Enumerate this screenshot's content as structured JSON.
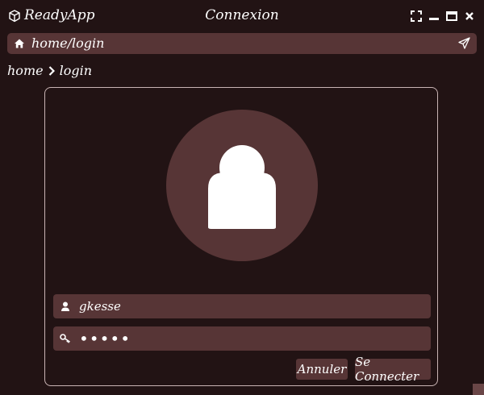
{
  "titlebar": {
    "app_name": "ReadyApp",
    "window_title": "Connexion",
    "app_icon": "cube-icon",
    "controls": [
      "fullscreen-icon",
      "minimize-icon",
      "maximize-icon",
      "close-icon"
    ]
  },
  "addressbar": {
    "path": "home/login",
    "home_icon": "home-icon",
    "send_icon": "paper-plane-icon"
  },
  "breadcrumb": {
    "items": [
      "home",
      "login"
    ],
    "separator_icon": "chevron-right-icon"
  },
  "login": {
    "avatar_icon": "user-icon",
    "username": {
      "value": "gkesse",
      "icon": "user-small-icon"
    },
    "password": {
      "value": "•••••",
      "icon": "key-icon"
    },
    "cancel_label": "Annuler",
    "connect_label": "Se Connecter"
  },
  "colors": {
    "background": "#221314",
    "surface": "#573536",
    "border": "#c9b4b4",
    "text": "#ffffff"
  }
}
